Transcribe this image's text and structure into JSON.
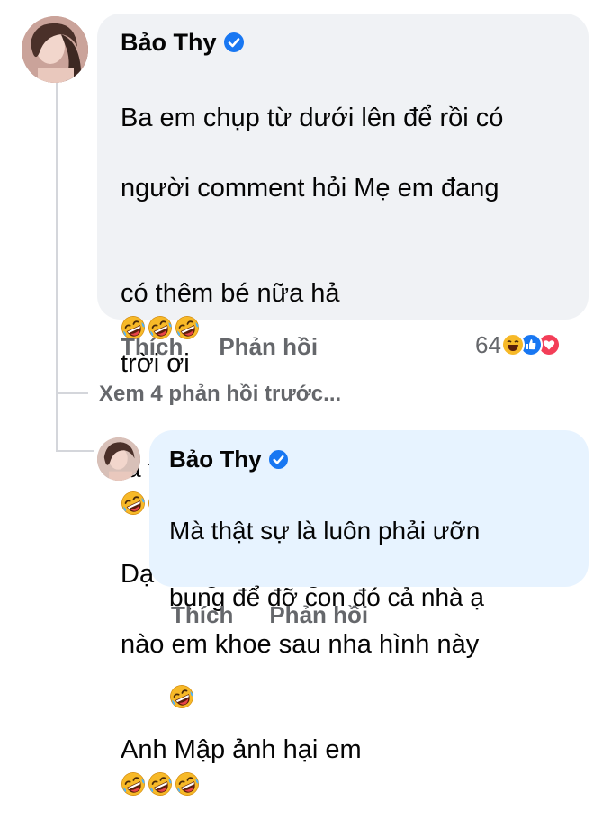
{
  "comment": {
    "author": "Bảo Thy",
    "text_lines": [
      "Ba em chụp từ dưới lên để rồi có",
      "người comment hỏi Mẹ em đang",
      "có thêm bé nữa hả",
      "trời ơi",
      "là trời",
      "Dạ bụng e thon gọn lắm rồi hôm",
      "nào em khoe sau nha hình này",
      "Anh Mập ảnh hại em"
    ],
    "like_label": "Thích",
    "reply_label": "Phản hồi",
    "reaction_count": "64"
  },
  "view_previous": "Xem 4 phản hồi trước...",
  "reply": {
    "author": "Bảo Thy",
    "text_lines": [
      "Mà thật sự là luôn phải ưỡn",
      "bụng để đỡ con đó cả nhà ạ"
    ],
    "like_label": "Thích",
    "reply_label": "Phản hồi"
  },
  "colors": {
    "verified_blue": "#1877f2",
    "bubble_gray": "#f0f2f5",
    "bubble_blue": "#e7f3ff",
    "meta_gray": "#65676b",
    "reaction_haha": "#f7b928",
    "reaction_like": "#1877f2",
    "reaction_love": "#f33e58"
  },
  "icons": [
    "verified-badge-icon",
    "laughing-emoji-icon",
    "haha-reaction-icon",
    "like-reaction-icon",
    "love-reaction-icon"
  ]
}
